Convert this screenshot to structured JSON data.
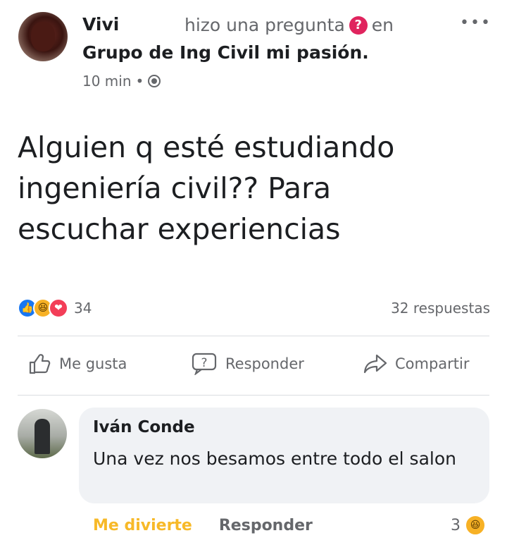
{
  "post": {
    "author": "Vivi",
    "action_text": "hizo una pregunta",
    "action_icon": "question-badge-icon",
    "action_suffix": "en",
    "group": "Grupo de Ing Civil mi pasión.",
    "time": "10 min",
    "separator": "•",
    "privacy_icon": "globe-icon",
    "more_label": "•••",
    "text": "Alguien q esté estudiando\ningeniería civil?? Para\nescuchar experiencias"
  },
  "stats": {
    "reaction_icons": [
      "like-icon",
      "haha-icon",
      "love-icon"
    ],
    "reaction_count": "34",
    "responses": "32 respuestas"
  },
  "actions": {
    "like": "Me gusta",
    "reply": "Responder",
    "share": "Compartir"
  },
  "comment": {
    "author": "Iván Conde",
    "text": "Una vez nos besamos entre todo el salon",
    "reaction_label": "Me divierte",
    "reply_label": "Responder",
    "reaction_count": "3",
    "reaction_icon": "haha-icon"
  },
  "colors": {
    "like_blue": "#1877f2",
    "haha_yellow": "#f7b928",
    "love_red": "#f33e58",
    "question_pink": "#e0245e",
    "muted_text": "#65676b"
  }
}
